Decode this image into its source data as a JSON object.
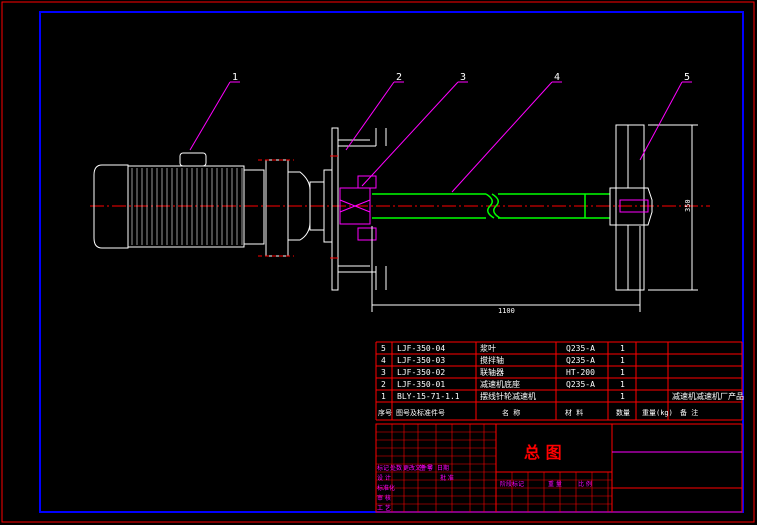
{
  "balloons": [
    "1",
    "2",
    "3",
    "4",
    "5"
  ],
  "dimensions": {
    "length": "1100",
    "height": "350"
  },
  "bom": {
    "rows": [
      {
        "no": "5",
        "code": "LJF-350-04",
        "name": "浆叶",
        "material": "Q235-A",
        "qty": "1",
        "note": ""
      },
      {
        "no": "4",
        "code": "LJF-350-03",
        "name": "搅拌轴",
        "material": "Q235-A",
        "qty": "1",
        "note": ""
      },
      {
        "no": "3",
        "code": "LJF-350-02",
        "name": "联轴器",
        "material": "HT-200",
        "qty": "1",
        "note": ""
      },
      {
        "no": "2",
        "code": "LJF-350-01",
        "name": "减速机底座",
        "material": "Q235-A",
        "qty": "1",
        "note": ""
      },
      {
        "no": "1",
        "code": "BLY-15-71-1.1",
        "name": "摆线针轮减速机",
        "material": "",
        "qty": "1",
        "note": "减速机减速机厂产品"
      }
    ],
    "header": {
      "no": "序号",
      "code": "图号及标准件号",
      "name": "名 称",
      "material": "材 料",
      "qty": "数量",
      "weight": "重量(kg)",
      "note": "备 注"
    }
  },
  "title_block": {
    "title": "总 图",
    "labels": [
      "标记",
      "处数",
      "更改文件号",
      "签 字",
      "日期",
      "设 计",
      "标准化",
      "审 核",
      "工 艺",
      "批 准",
      "阶段标记",
      "重 量",
      "比 例"
    ]
  },
  "colors": {
    "frame": "#0000ff",
    "outer": "#ff0000",
    "part": "#ffffff",
    "shaft": "#00ff00",
    "leader": "#ff00ff",
    "center": "#ff0000",
    "table": "#ff0000"
  }
}
